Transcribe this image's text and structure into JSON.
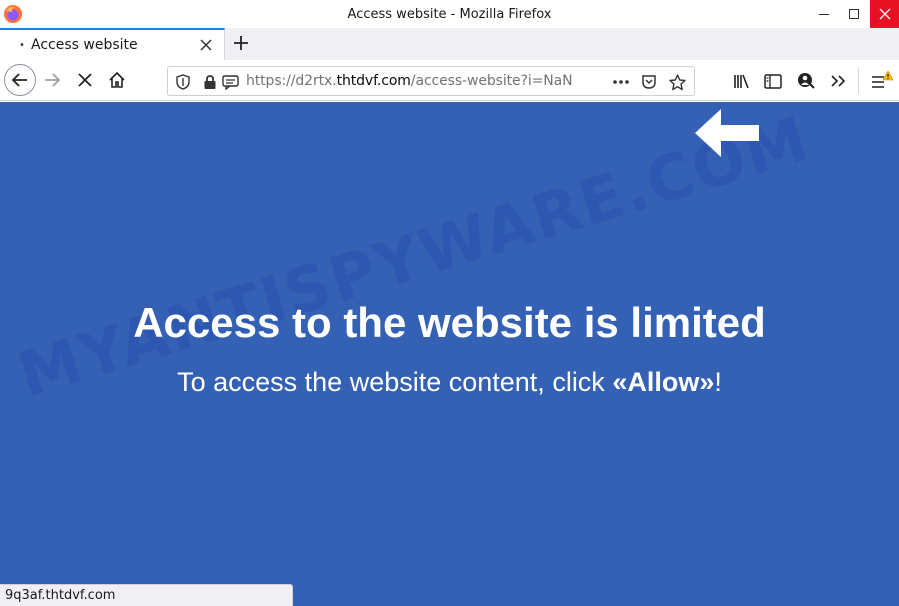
{
  "window": {
    "title": "Access website - Mozilla Firefox"
  },
  "tabs": [
    {
      "label": "Access website",
      "active": true
    }
  ],
  "navbar": {
    "url_prefix": "https://d2rtx.",
    "url_domain": "thtdvf.com",
    "url_suffix": "/access-website?i=NaN"
  },
  "page": {
    "headline": "Access to the website is limited",
    "subline_before": "To access the website content, click ",
    "subline_bold": "«Allow»",
    "subline_after": "!",
    "watermark": "MYANTISPYWARE.COM",
    "background_color": "#3461b3"
  },
  "status": {
    "text": "9q3af.thtdvf.com"
  },
  "colors": {
    "close_red": "#e81123",
    "tab_accent": "#0a84ff",
    "warning_badge": "#ffbf00"
  },
  "icons": [
    "firefox-logo",
    "minimize-icon",
    "maximize-icon",
    "close-icon",
    "tab-close-icon",
    "plus-icon",
    "back-arrow-icon",
    "forward-arrow-icon",
    "stop-icon",
    "home-icon",
    "shield-icon",
    "lock-icon",
    "message-icon",
    "more-dots-icon",
    "pocket-icon",
    "star-icon",
    "library-icon",
    "sidebar-icon",
    "account-icon",
    "overflow-chevrons-icon",
    "hamburger-menu-icon",
    "white-arrow-icon"
  ]
}
